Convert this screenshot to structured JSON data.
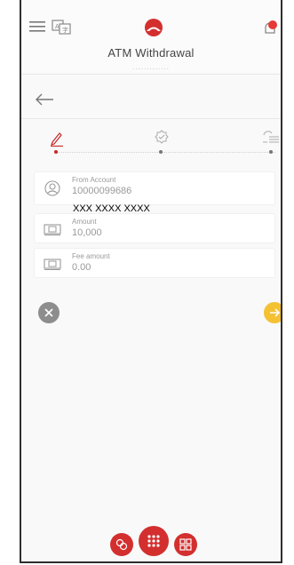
{
  "header": {
    "title": "ATM Withdrawal",
    "subtitle_dots": ".............",
    "notification_badge": "0",
    "menu_icon": "hamburger-menu-icon",
    "language_icon": "language-icon"
  },
  "steps": [
    {
      "name": "edit-step-icon",
      "active": true
    },
    {
      "name": "verify-step-icon",
      "active": false
    },
    {
      "name": "confirm-step-icon",
      "active": false
    }
  ],
  "form": {
    "from_account": {
      "label": "From Account",
      "value": "10000099686",
      "masked": "XXX XXXX XXXX"
    },
    "amount": {
      "label": "Amount",
      "value": "10,000"
    },
    "fee_amount": {
      "label": "Fee amount",
      "value": "0.00"
    }
  },
  "colors": {
    "brand_red": "#d32f2f",
    "accent_yellow": "#f4c133",
    "cancel_gray": "#8d8d8d"
  }
}
